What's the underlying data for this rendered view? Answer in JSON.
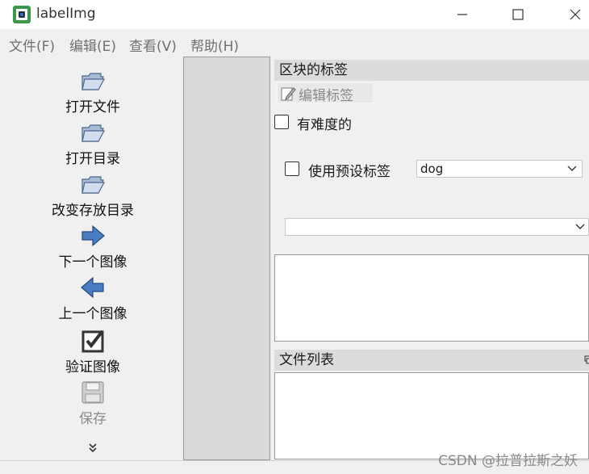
{
  "window": {
    "title": "labelImg",
    "minimize": "—",
    "maximize": "☐",
    "close": "✕"
  },
  "menu": [
    {
      "label": "文件(F)"
    },
    {
      "label": "编辑(E)"
    },
    {
      "label": "查看(V)"
    },
    {
      "label": "帮助(H)"
    }
  ],
  "toolbar": {
    "items": [
      {
        "label": "打开文件",
        "icon": "folder-open-icon"
      },
      {
        "label": "打开目录",
        "icon": "folder-open-icon"
      },
      {
        "label": "改变存放目录",
        "icon": "folder-open-icon"
      },
      {
        "label": "下一个图像",
        "icon": "arrow-right-icon"
      },
      {
        "label": "上一个图像",
        "icon": "arrow-left-icon"
      },
      {
        "label": "验证图像",
        "icon": "checkbox-verify-icon"
      },
      {
        "label": "保存",
        "icon": "save-icon",
        "disabled": true
      }
    ],
    "more": "»"
  },
  "labels_dock": {
    "title": "区块的标签",
    "edit_label_button": "编辑标签",
    "difficult_label": "有难度的",
    "use_default_label": "使用预设标签",
    "default_label_value": "dog",
    "second_combo_value": ""
  },
  "file_dock": {
    "title": "文件列表"
  },
  "watermark": "CSDN @拉普拉斯之妖",
  "colors": {
    "arrow_blue": "#3d6fb6",
    "folder_blue": "#6b86b0",
    "dock_title_bg": "#dcdcdc"
  }
}
